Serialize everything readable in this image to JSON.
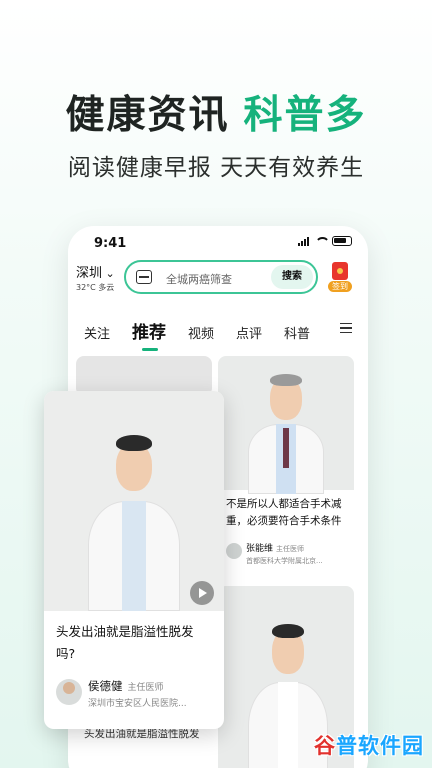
{
  "hero": {
    "title_dark": "健康资讯",
    "title_green": "科普多",
    "subtitle": "阅读健康早报  天天有效养生"
  },
  "status_bar": {
    "time": "9:41"
  },
  "location": {
    "city": "深圳",
    "weather": "32°C 多云"
  },
  "search": {
    "placeholder": "全城两癌筛查",
    "button": "搜索"
  },
  "signin": {
    "label": "签到"
  },
  "tabs": [
    "关注",
    "推荐",
    "视频",
    "点评",
    "科普"
  ],
  "featured_card": {
    "title": "头发出油就是脂溢性脱发吗?",
    "author": {
      "name": "侯德健",
      "role": "主任医师",
      "hospital": "深圳市宝安区人民医院..."
    }
  },
  "right_card": {
    "title": "不是所以人都适合手术减重，必须要符合手术条件",
    "author": {
      "name": "张能维",
      "role": "主任医师",
      "hospital": "首都医科大学附属北京..."
    }
  },
  "left_bottom_title": "头发出油就是脂溢性脱发",
  "watermark": {
    "first": "谷",
    "rest": "普软件园"
  },
  "colors": {
    "accent": "#16b27c",
    "search_border": "#3cc596"
  }
}
